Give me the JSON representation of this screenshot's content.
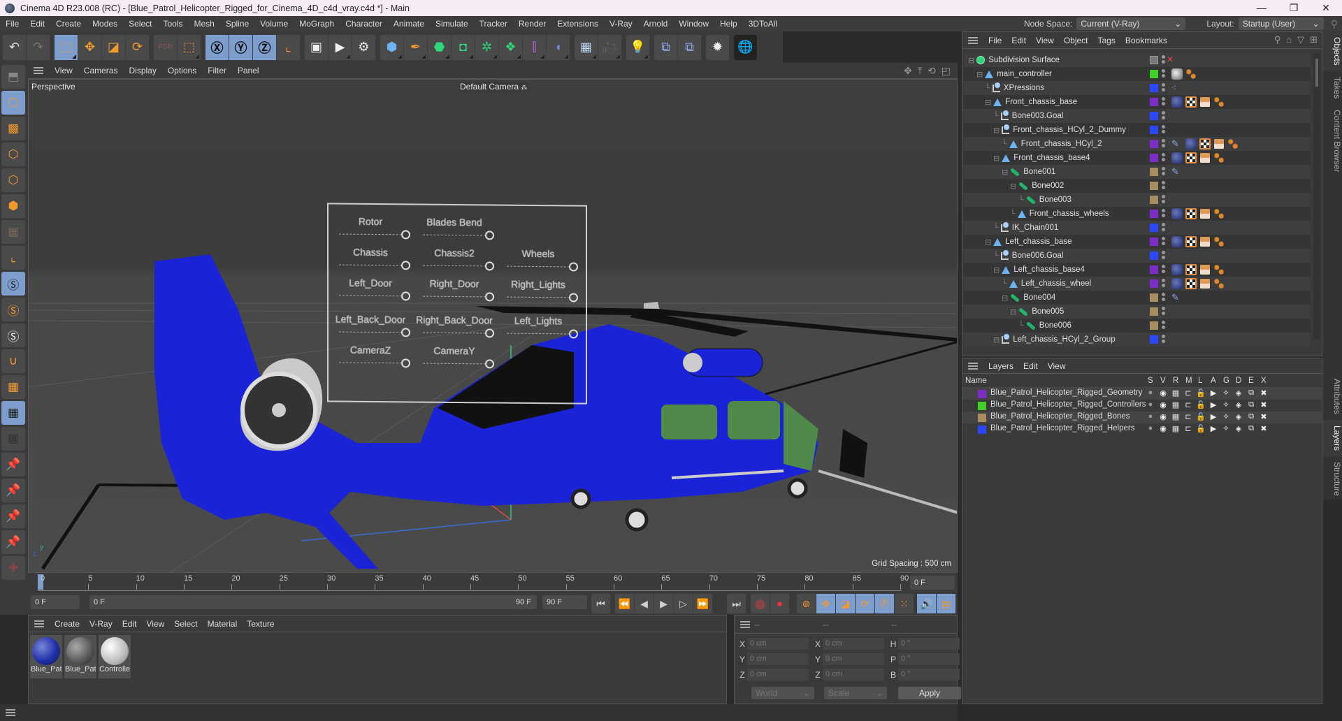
{
  "window": {
    "title": "Cinema 4D R23.008 (RC) - [Blue_Patrol_Helicopter_Rigged_for_Cinema_4D_c4d_vray.c4d *] - Main",
    "controls": [
      "minimize",
      "maximize",
      "close"
    ]
  },
  "menubar": {
    "items": [
      "File",
      "Edit",
      "Create",
      "Modes",
      "Select",
      "Tools",
      "Mesh",
      "Spline",
      "Volume",
      "MoGraph",
      "Character",
      "Animate",
      "Simulate",
      "Tracker",
      "Render",
      "Extensions",
      "V-Ray",
      "Arnold",
      "Window",
      "Help",
      "3DToAll"
    ],
    "node_space_label": "Node Space:",
    "node_space_value": "Current (V-Ray)",
    "layout_label": "Layout:",
    "layout_value": "Startup (User)"
  },
  "toolbar": {
    "groups": [
      [
        "undo-icon",
        "redo-icon"
      ],
      [
        "live-selection-icon",
        "move-icon",
        "scale-icon",
        "rotate-icon"
      ],
      [
        "psr-icon",
        "selection-filter-icon"
      ],
      [
        "x-axis-icon",
        "y-axis-icon",
        "z-axis-icon",
        "coordinate-system-icon"
      ],
      [
        "render-view-icon",
        "render-picture-viewer-icon",
        "render-settings-icon"
      ],
      [
        "cube-icon",
        "pen-icon",
        "subdivision-icon",
        "extrude-icon",
        "array-icon",
        "cloner-icon",
        "symmetry-icon",
        "deformer-icon"
      ],
      [
        "floor-icon",
        "camera-icon"
      ],
      [
        "light-icon"
      ],
      [
        "python-icon",
        "python-icon"
      ],
      [
        "gear-icon"
      ],
      [
        "sphere-wire-icon"
      ]
    ]
  },
  "leftbar": {
    "tools": [
      "make-editable-icon",
      "model-mode-icon",
      "texture-mode-icon",
      "point-mode-icon",
      "edge-mode-icon",
      "polygon-mode-icon",
      "uv-mode-icon",
      "axis-mode-icon",
      "solo-off-icon",
      "solo-icon",
      "solo-hierarchy-icon",
      "snap-icon",
      "workplane-icon",
      "locked-workplane-icon",
      "workplane-align-icon",
      "pin-icon",
      "pin-p-icon",
      "pin-r-icon",
      "pin-target-icon",
      "add-pin-icon"
    ]
  },
  "viewport": {
    "menu": [
      "View",
      "Cameras",
      "Display",
      "Options",
      "Filter",
      "Panel"
    ],
    "projection": "Perspective",
    "camera": "Default Camera",
    "grid_spacing": "Grid Spacing : 500 cm",
    "controls": [
      {
        "label": "Rotor"
      },
      {
        "label": "Blades Bend"
      },
      {
        "label": "Chassis"
      },
      {
        "label": "Chassis2"
      },
      {
        "label": "Wheels"
      },
      {
        "label": "Left_Door"
      },
      {
        "label": "Right_Door"
      },
      {
        "label": "Right_Lights"
      },
      {
        "label": "Left_Back_Door"
      },
      {
        "label": "Right_Back_Door"
      },
      {
        "label": "Left_Lights"
      },
      {
        "label": "CameraZ"
      },
      {
        "label": "CameraY"
      }
    ],
    "colors": {
      "helicopter": "#1a24d6",
      "glass": "#4f8a4a"
    }
  },
  "timeline": {
    "ticks": [
      "0",
      "5",
      "10",
      "15",
      "20",
      "25",
      "30",
      "35",
      "40",
      "45",
      "50",
      "55",
      "60",
      "65",
      "70",
      "75",
      "80",
      "85",
      "90"
    ],
    "current_frame": "0 F",
    "start_field": "0 F",
    "range_start": "0 F",
    "range_end": "90 F",
    "end_field": "90 F"
  },
  "materials": {
    "menu": [
      "Create",
      "V-Ray",
      "Edit",
      "View",
      "Select",
      "Material",
      "Texture"
    ],
    "items": [
      {
        "label": "Blue_Pat",
        "style": "blue"
      },
      {
        "label": "Blue_Pat",
        "style": "grey-red"
      },
      {
        "label": "Controlle",
        "style": "white"
      }
    ]
  },
  "coordinates": {
    "headers": [
      "--",
      "--",
      "--"
    ],
    "rows": [
      {
        "a": "X",
        "av": "0 cm",
        "b": "X",
        "bv": "0 cm",
        "c": "H",
        "cv": "0 °"
      },
      {
        "a": "Y",
        "av": "0 cm",
        "b": "Y",
        "bv": "0 cm",
        "c": "P",
        "cv": "0 °"
      },
      {
        "a": "Z",
        "av": "0 cm",
        "b": "Z",
        "bv": "0 cm",
        "c": "B",
        "cv": "0 °"
      }
    ],
    "space": "World",
    "mode": "Scale",
    "apply": "Apply"
  },
  "objects": {
    "menu": [
      "File",
      "Edit",
      "View",
      "Object",
      "Tags",
      "Bookmarks"
    ],
    "rows": [
      {
        "name": "Subdivision Surface",
        "depth": 0,
        "icon": "sub",
        "layer": "#777777",
        "tags": [],
        "expand": true
      },
      {
        "name": "main_controller",
        "depth": 1,
        "icon": "null",
        "layer": "#3fd125",
        "tags": [
          "grey",
          "ik"
        ],
        "expand": true
      },
      {
        "name": "XPressions",
        "depth": 2,
        "icon": "goal",
        "layer": "#2b48ff",
        "tags": [
          "xp"
        ]
      },
      {
        "name": "Front_chassis_base",
        "depth": 2,
        "icon": "null",
        "layer": "#7e2dc8",
        "tags": [
          "mat1",
          "checker",
          "uv",
          "ik"
        ],
        "expand": true
      },
      {
        "name": "Bone003.Goal",
        "depth": 3,
        "icon": "goal",
        "layer": "#2b48ff",
        "tags": []
      },
      {
        "name": "Front_chassis_HCyl_2_Dummy",
        "depth": 3,
        "icon": "goal",
        "layer": "#2b48ff",
        "tags": [],
        "expand": true
      },
      {
        "name": "Front_chassis_HCyl_2",
        "depth": 4,
        "icon": "null",
        "layer": "#7e2dc8",
        "tags": [
          "pin",
          "mat1",
          "checker",
          "uv",
          "ik"
        ]
      },
      {
        "name": "Front_chassis_base4",
        "depth": 3,
        "icon": "null",
        "layer": "#7e2dc8",
        "tags": [
          "mat1",
          "checker",
          "uv",
          "ik"
        ],
        "expand": true
      },
      {
        "name": "Bone001",
        "depth": 4,
        "icon": "bone",
        "layer": "#a88e5e",
        "tags": [
          "pin"
        ],
        "expand": true
      },
      {
        "name": "Bone002",
        "depth": 5,
        "icon": "bone",
        "layer": "#a88e5e",
        "tags": [],
        "expand": true
      },
      {
        "name": "Bone003",
        "depth": 6,
        "icon": "bone",
        "layer": "#a88e5e",
        "tags": []
      },
      {
        "name": "Front_chassis_wheels",
        "depth": 5,
        "icon": "null",
        "layer": "#7e2dc8",
        "tags": [
          "mat1",
          "checker",
          "uv",
          "ik"
        ]
      },
      {
        "name": "IK_Chain001",
        "depth": 3,
        "icon": "goal",
        "layer": "#2b48ff",
        "tags": []
      },
      {
        "name": "Left_chassis_base",
        "depth": 2,
        "icon": "null",
        "layer": "#7e2dc8",
        "tags": [
          "mat1",
          "checker",
          "uv",
          "ik"
        ],
        "expand": true
      },
      {
        "name": "Bone006.Goal",
        "depth": 3,
        "icon": "goal",
        "layer": "#2b48ff",
        "tags": []
      },
      {
        "name": "Left_chassis_base4",
        "depth": 3,
        "icon": "null",
        "layer": "#7e2dc8",
        "tags": [
          "mat1",
          "checker",
          "uv",
          "ik"
        ],
        "expand": true
      },
      {
        "name": "Left_chassis_wheel",
        "depth": 4,
        "icon": "null",
        "layer": "#7e2dc8",
        "tags": [
          "mat1",
          "checker",
          "uv",
          "ik"
        ]
      },
      {
        "name": "Bone004",
        "depth": 4,
        "icon": "bone",
        "layer": "#a88e5e",
        "tags": [
          "pin"
        ],
        "expand": true
      },
      {
        "name": "Bone005",
        "depth": 5,
        "icon": "bone",
        "layer": "#a88e5e",
        "tags": [],
        "expand": true
      },
      {
        "name": "Bone006",
        "depth": 6,
        "icon": "bone",
        "layer": "#a88e5e",
        "tags": []
      },
      {
        "name": "Left_chassis_HCyl_2_Group",
        "depth": 3,
        "icon": "goal",
        "layer": "#2b48ff",
        "tags": [],
        "expand": true
      }
    ]
  },
  "sidetabs": {
    "top": [
      {
        "label": "Objects",
        "active": true
      },
      {
        "label": "Takes"
      },
      {
        "label": "Content Browser"
      }
    ],
    "bottom": [
      {
        "label": "Attributes"
      },
      {
        "label": "Layers",
        "active": true
      },
      {
        "label": "Structure"
      }
    ]
  },
  "layers": {
    "menu": [
      "Layers",
      "Edit",
      "View"
    ],
    "name_header": "Name",
    "columns": [
      "S",
      "V",
      "R",
      "M",
      "L",
      "A",
      "G",
      "D",
      "E",
      "X"
    ],
    "rows": [
      {
        "name": "Blue_Patrol_Helicopter_Rigged_Geometry",
        "color": "#7e2dc8"
      },
      {
        "name": "Blue_Patrol_Helicopter_Rigged_Controllers",
        "color": "#3fd125"
      },
      {
        "name": "Blue_Patrol_Helicopter_Rigged_Bones",
        "color": "#a88e5e"
      },
      {
        "name": "Blue_Patrol_Helicopter_Rigged_Helpers",
        "color": "#2b48ff"
      }
    ]
  }
}
